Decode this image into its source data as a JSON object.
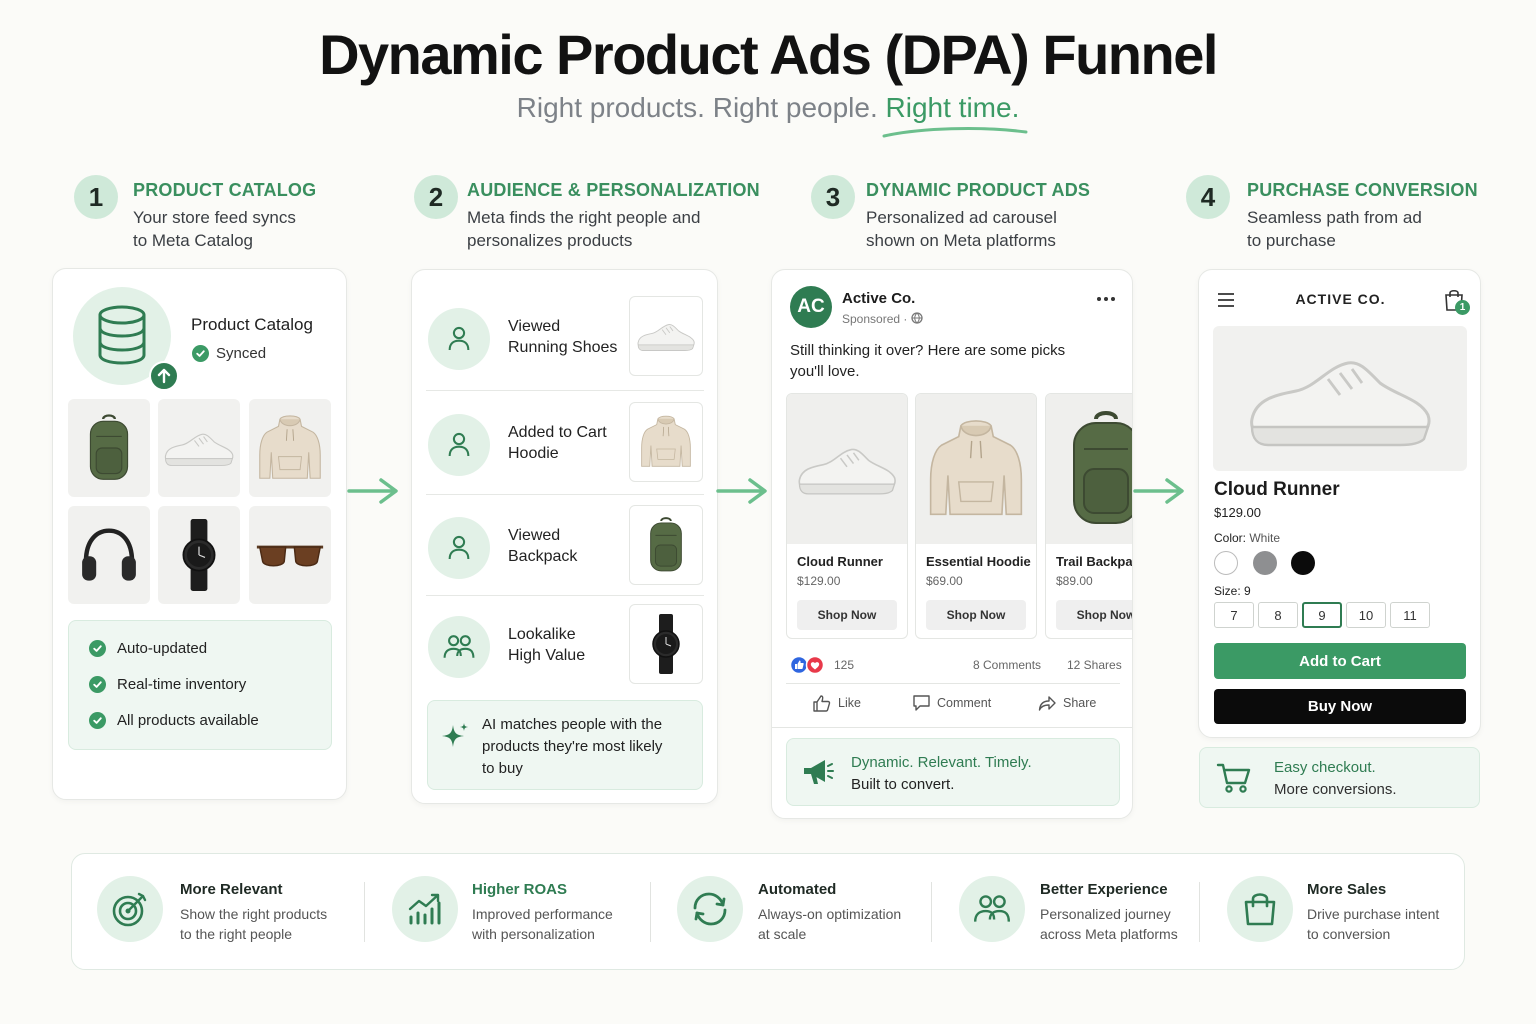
{
  "title": "Dynamic Product Ads (DPA) Funnel",
  "subtitle": {
    "part1": "Right products. Right people.",
    "highlight": "Right time."
  },
  "colors": {
    "accent": "#3b9a65",
    "accent_dark": "#2f7c52",
    "accent_light": "#e2f1e7",
    "background": "#fbfbf8"
  },
  "steps": [
    {
      "number": "1",
      "title": "PRODUCT CATALOG",
      "desc1": "Your store feed syncs",
      "desc2": "to Meta Catalog"
    },
    {
      "number": "2",
      "title": "AUDIENCE & PERSONALIZATION",
      "desc1": "Meta finds the right people and",
      "desc2": "personalizes products"
    },
    {
      "number": "3",
      "title": "DYNAMIC PRODUCT ADS",
      "desc1": "Personalized ad carousel",
      "desc2": "shown on Meta platforms"
    },
    {
      "number": "4",
      "title": "PURCHASE CONVERSION",
      "desc1": "Seamless path from ad",
      "desc2": "to purchase"
    }
  ],
  "catalog": {
    "name": "Product Catalog",
    "status": "Synced",
    "products": [
      "backpack",
      "sneaker",
      "hoodie",
      "headphones",
      "watch",
      "sunglasses"
    ],
    "features": [
      "Auto-updated",
      "Real-time inventory",
      "All products available"
    ]
  },
  "audience": {
    "segments": [
      {
        "line1": "Viewed",
        "line2": "Running Shoes",
        "icon": "person-icon",
        "thumb": "sneaker"
      },
      {
        "line1": "Added to Cart",
        "line2": "Hoodie",
        "icon": "person-icon",
        "thumb": "hoodie"
      },
      {
        "line1": "Viewed",
        "line2": "Backpack",
        "icon": "person-icon",
        "thumb": "backpack"
      },
      {
        "line1": "Lookalike",
        "line2": "High Value",
        "icon": "people-icon",
        "thumb": "watch"
      }
    ],
    "ai_note": {
      "line1": "AI matches people with the",
      "line2": "products they're most likely",
      "line3": "to buy"
    }
  },
  "ad": {
    "avatar": "AC",
    "brand": "Active Co.",
    "sponsored": "Sponsored ·",
    "text1": "Still thinking it over? Here are some picks",
    "text2": "you'll love.",
    "carousel": [
      {
        "name": "Cloud Runner",
        "price": "$129.00",
        "cta": "Shop Now"
      },
      {
        "name": "Essential Hoodie",
        "price": "$69.00",
        "cta": "Shop Now"
      },
      {
        "name": "Trail Backpack",
        "price": "$89.00",
        "cta": "Shop Now"
      }
    ],
    "reactions": "125",
    "comments": "8 Comments",
    "shares": "12 Shares",
    "actions": {
      "like": "Like",
      "comment": "Comment",
      "share": "Share"
    },
    "tagline1": "Dynamic. Relevant. Timely.",
    "tagline2": "Built to convert."
  },
  "store": {
    "brand": "ACTIVE CO.",
    "cart_count": "1",
    "product_name": "Cloud Runner",
    "price": "$129.00",
    "color_label": "Color:",
    "color_value": "White",
    "swatches": [
      "#ffffff",
      "#8e8f91",
      "#0b0b0b"
    ],
    "size_label": "Size: 9",
    "sizes": [
      "7",
      "8",
      "9",
      "10",
      "11"
    ],
    "selected_size": "9",
    "add_to_cart": "Add to Cart",
    "buy_now": "Buy Now",
    "checkout1": "Easy checkout.",
    "checkout2": "More conversions."
  },
  "benefits": [
    {
      "title": "More Relevant",
      "desc1": "Show the right products",
      "desc2": "to the right people",
      "icon": "target-icon"
    },
    {
      "title": "Higher ROAS",
      "desc1": "Improved performance",
      "desc2": "with personalization",
      "icon": "chart-growth-icon"
    },
    {
      "title": "Automated",
      "desc1": "Always-on optimization",
      "desc2": "at scale",
      "icon": "refresh-icon"
    },
    {
      "title": "Better Experience",
      "desc1": "Personalized journey",
      "desc2": "across Meta platforms",
      "icon": "people-icon"
    },
    {
      "title": "More Sales",
      "desc1": "Drive purchase intent",
      "desc2": "to conversion",
      "icon": "shopping-bag-icon"
    }
  ]
}
